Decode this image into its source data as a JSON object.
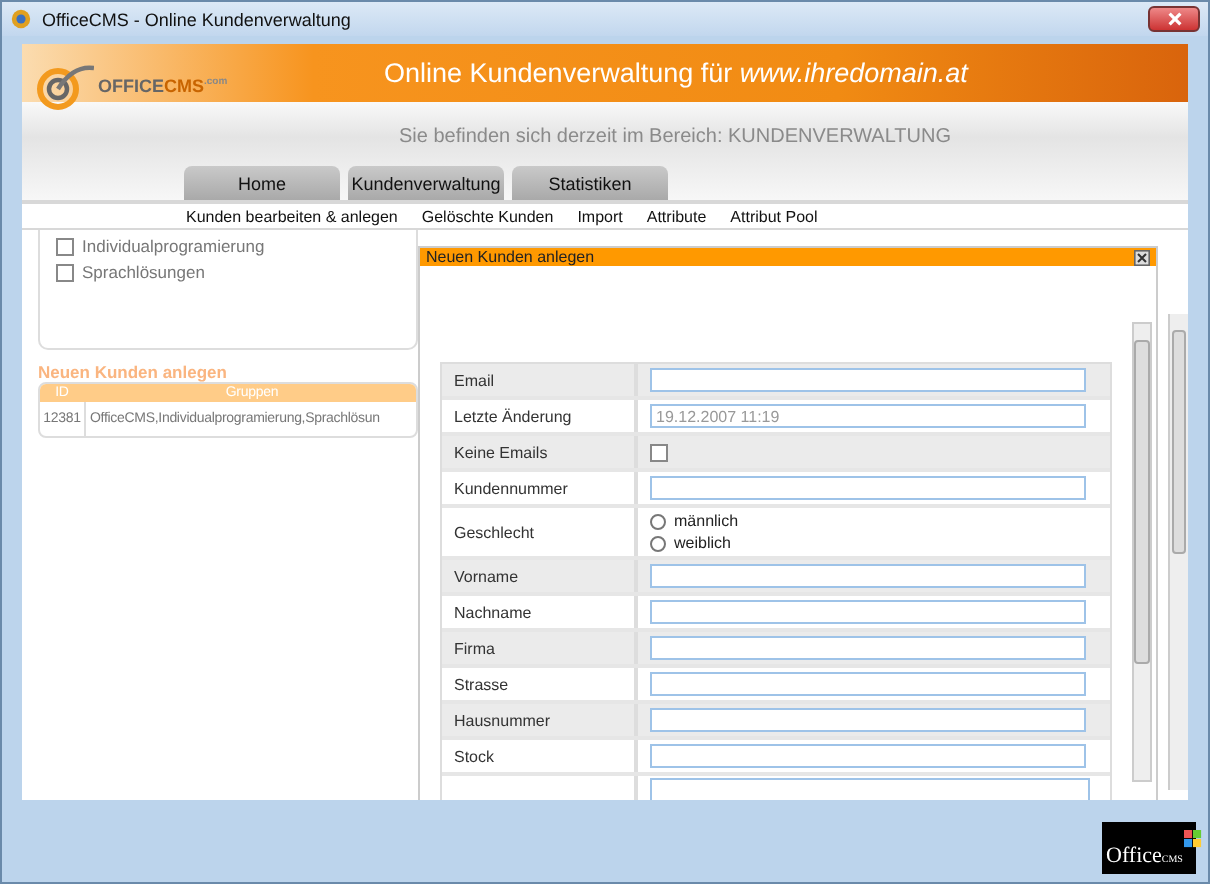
{
  "window": {
    "title": "OfficeCMS - Online Kundenverwaltung"
  },
  "logo": {
    "brand_1": "OFFICE",
    "brand_2": "CMS",
    "suffix": ".com"
  },
  "header": {
    "title": "Online Kundenverwaltung für *www.ihredomain.at*",
    "location": "Sie befinden sich derzeit im Bereich: KUNDENVERWALTUNG"
  },
  "tabs": [
    {
      "label": "Home"
    },
    {
      "label": "Kundenverwaltung"
    },
    {
      "label": "Statistiken"
    }
  ],
  "subnav": [
    "Kunden bearbeiten & anlegen",
    "Gelöschte Kunden",
    "Import",
    "Attribute",
    "Attribut Pool"
  ],
  "groups": [
    {
      "label": "Individualprogramierung",
      "checked": false
    },
    {
      "label": "Sprachlösungen",
      "checked": false
    }
  ],
  "list": {
    "title": "Neuen Kunden anlegen",
    "columns": [
      "ID",
      "Gruppen"
    ],
    "rows": [
      [
        "12381",
        "OfficeCMS,Individualprogramierung,Sprachlösun"
      ]
    ]
  },
  "dialog": {
    "title": "Neuen Kunden anlegen",
    "fields": [
      {
        "kind": "text",
        "label": "Email",
        "shaded": true
      },
      {
        "kind": "text",
        "label": "Letzte Änderung",
        "value": "19.12.2007 11:19",
        "disabled": true,
        "shaded": false
      },
      {
        "kind": "checkbox",
        "label": "Keine Emails",
        "checked": false,
        "shaded": true
      },
      {
        "kind": "text",
        "label": "Kundennummer",
        "shaded": false
      },
      {
        "kind": "radio",
        "label": "Geschlecht",
        "shaded": false,
        "options": [
          {
            "label": "männlich",
            "selected": false
          },
          {
            "label": "weiblich",
            "selected": false
          }
        ]
      },
      {
        "kind": "text",
        "label": "Vorname",
        "shaded": true
      },
      {
        "kind": "text",
        "label": "Nachname",
        "shaded": false
      },
      {
        "kind": "text",
        "label": "Firma",
        "shaded": true
      },
      {
        "kind": "text",
        "label": "Strasse",
        "shaded": false
      },
      {
        "kind": "text",
        "label": "Hausnummer",
        "shaded": true
      },
      {
        "kind": "text",
        "label": "Stock",
        "shaded": false
      }
    ]
  },
  "footer_logo": {
    "word": "Office",
    "small": "CMS"
  }
}
